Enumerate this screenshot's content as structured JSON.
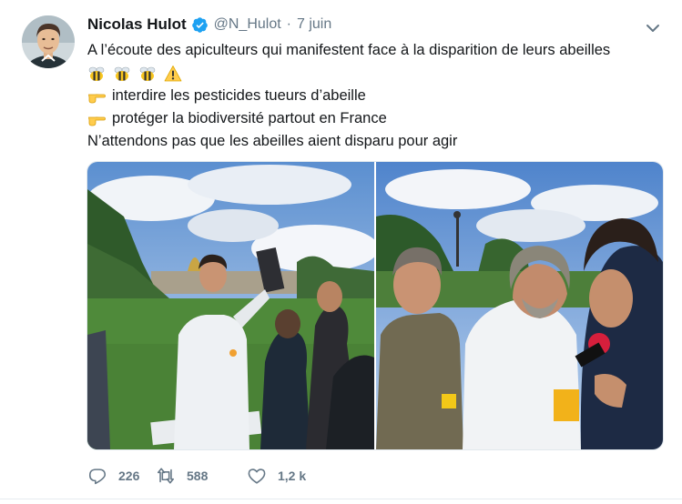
{
  "author": {
    "name": "Nicolas Hulot",
    "handle": "@N_Hulot",
    "separator": "·",
    "date": "7 juin",
    "verified": true
  },
  "tweet": {
    "line1": "A l’écoute des apiculteurs qui manifestent face à la disparition de leurs abeilles",
    "line2_emojis": [
      "bee-emoji",
      "bee-emoji",
      "bee-emoji",
      "warning-emoji"
    ],
    "line3": "interdire les pesticides tueurs d’abeille",
    "line4": "protéger la biodiversité partout en France",
    "line5": "N’attendons pas que les abeilles aient disparu pour agir",
    "bullet_icon": "pointing-hand-emoji"
  },
  "media": {
    "photos": [
      "protest-photo-beekeeper",
      "protest-photo-interview"
    ]
  },
  "actions": {
    "replies": "226",
    "retweets": "588",
    "likes": "1,2 k"
  },
  "colors": {
    "verified": "#1da1f2",
    "muted": "#657786",
    "text": "#14171a"
  }
}
